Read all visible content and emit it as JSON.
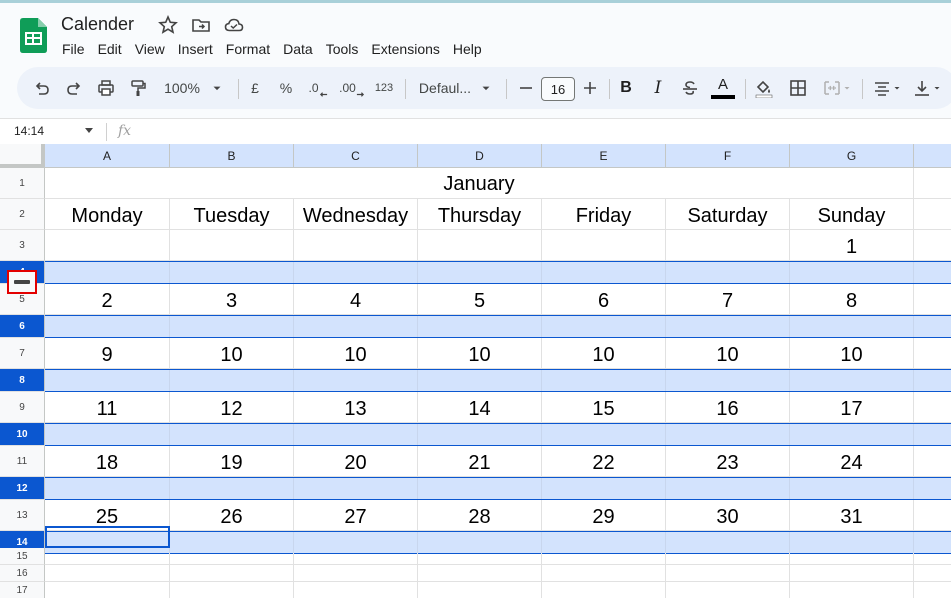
{
  "app": {
    "title": "Calender",
    "menu": [
      "File",
      "Edit",
      "View",
      "Insert",
      "Format",
      "Data",
      "Tools",
      "Extensions",
      "Help"
    ]
  },
  "toolbar": {
    "zoom": "100%",
    "currency": "£",
    "percent": "%",
    "decrease_decimal": ".0",
    "increase_decimal": ".00",
    "number_format": "123",
    "font": "Defaul...",
    "font_size": "16",
    "bold": "B",
    "italic": "I",
    "text_color": "A"
  },
  "formula_bar": {
    "name_box": "14:14",
    "fx": "fx"
  },
  "columns": [
    "A",
    "B",
    "C",
    "D",
    "E",
    "F",
    "G"
  ],
  "rows": [
    "1",
    "2",
    "3",
    "4",
    "5",
    "6",
    "7",
    "8",
    "9",
    "10",
    "11",
    "12",
    "13",
    "14",
    "15",
    "16",
    "17"
  ],
  "sheet": {
    "month": "January",
    "days": [
      "Monday",
      "Tuesday",
      "Wednesday",
      "Thursday",
      "Friday",
      "Saturday",
      "Sunday"
    ],
    "week_rows": [
      [
        "",
        "",
        "",
        "",
        "",
        "",
        "1"
      ],
      [
        "2",
        "3",
        "4",
        "5",
        "6",
        "7",
        "8"
      ],
      [
        "9",
        "10",
        "10",
        "10",
        "10",
        "10",
        "10"
      ],
      [
        "11",
        "12",
        "13",
        "14",
        "15",
        "16",
        "17"
      ],
      [
        "18",
        "19",
        "20",
        "21",
        "22",
        "23",
        "24"
      ],
      [
        "25",
        "26",
        "27",
        "28",
        "29",
        "30",
        "31"
      ]
    ]
  },
  "colors": {
    "selection": "#d3e3fd",
    "accent": "#0b57d0",
    "highlight_box": "#e30000"
  }
}
